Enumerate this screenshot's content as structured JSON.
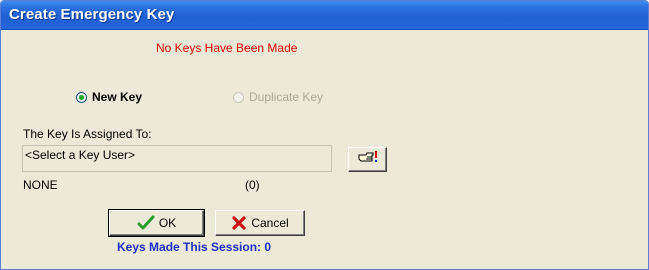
{
  "window": {
    "title": "Create Emergency Key"
  },
  "status_message": "No Keys Have Been Made",
  "key_type": {
    "options": [
      {
        "label": "New Key",
        "selected": true,
        "enabled": true
      },
      {
        "label": "Duplicate Key",
        "selected": false,
        "enabled": false
      }
    ]
  },
  "assignment": {
    "label": "The Key Is Assigned To:",
    "field_value": "<Select a Key User>",
    "select_button_icon": "pointing-hand-icon",
    "user_name": "NONE",
    "user_count": "(0)"
  },
  "buttons": {
    "ok_label": "OK",
    "ok_icon": "checkmark-icon",
    "cancel_label": "Cancel",
    "cancel_icon": "x-icon"
  },
  "session": {
    "text": "Keys Made This Session: 0"
  },
  "colors": {
    "titlebar": "#1e5fd4",
    "window_bg": "#ece9d8",
    "status_message": "#e00000",
    "session_text": "#1f2fc8",
    "ok_check": "#2a9a2a",
    "cancel_x": "#cc1111"
  }
}
